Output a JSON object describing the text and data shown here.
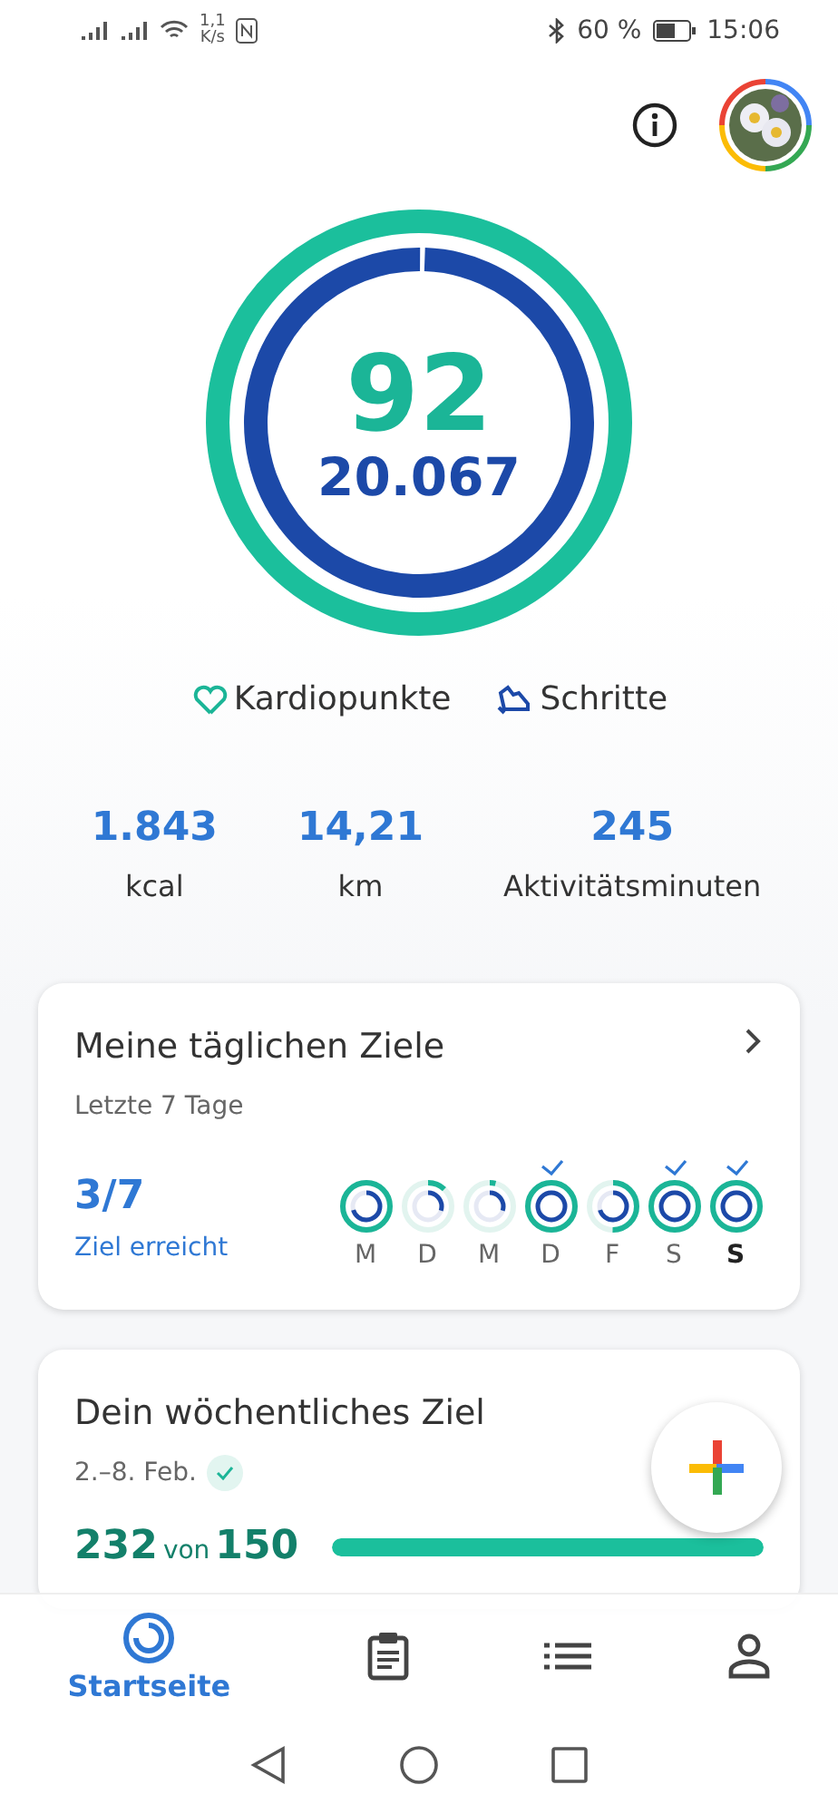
{
  "status_bar": {
    "speed": "1,1",
    "speed_unit": "K/s",
    "battery": "60 %",
    "time": "15:06"
  },
  "rings": {
    "heart": {
      "value": "92"
    },
    "steps": {
      "value": "20.067"
    }
  },
  "legend": [
    {
      "kind": "heart",
      "label": "Kardiopunkte"
    },
    {
      "kind": "steps",
      "label": "Schritte"
    }
  ],
  "stats": [
    {
      "value": "1.843",
      "label": "kcal"
    },
    {
      "value": "14,21",
      "label": "km"
    },
    {
      "value": "245",
      "label": "Aktivitätsminuten"
    }
  ],
  "daily_goals": {
    "title": "Meine täglichen Ziele",
    "subtitle": "Letzte 7 Tage",
    "count": "3/7",
    "caption": "Ziel erreicht",
    "days": [
      {
        "label": "M",
        "goal_met": false,
        "selected": false
      },
      {
        "label": "D",
        "goal_met": false,
        "selected": false
      },
      {
        "label": "M",
        "goal_met": false,
        "selected": false
      },
      {
        "label": "D",
        "goal_met": true,
        "selected": false
      },
      {
        "label": "F",
        "goal_met": false,
        "selected": false
      },
      {
        "label": "S",
        "goal_met": true,
        "selected": false
      },
      {
        "label": "S",
        "goal_met": true,
        "selected": true
      }
    ]
  },
  "weekly_goal": {
    "title": "Dein wöchentliches Ziel",
    "dates": "2.–8. Feb.",
    "achieved": true,
    "value": "232",
    "connector": "von",
    "target": "150",
    "level": 1
  },
  "nav": [
    {
      "kind": "home",
      "label": "Startseite",
      "selected": true
    },
    {
      "kind": "journal",
      "selected": false
    },
    {
      "kind": "browse",
      "selected": false
    },
    {
      "kind": "profile",
      "selected": false
    }
  ]
}
